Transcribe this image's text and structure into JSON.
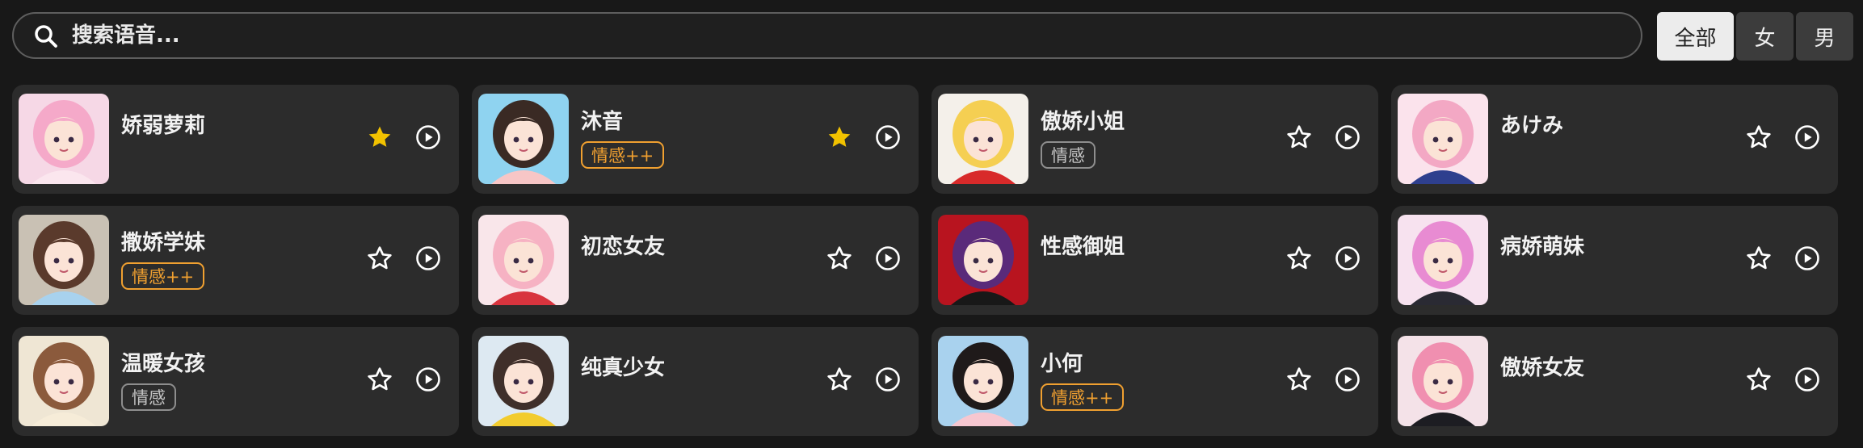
{
  "search": {
    "placeholder": "搜索语音..."
  },
  "filters": [
    {
      "label": "全部",
      "active": true
    },
    {
      "label": "女",
      "active": false
    },
    {
      "label": "男",
      "active": false
    }
  ],
  "colors": {
    "favorite": "#f2c200",
    "tag_plus": "#f0a030",
    "tag_plain": "#8e8e8e",
    "card_bg": "#2c2c2c"
  },
  "voices": [
    {
      "name": "娇弱萝莉",
      "tag": "",
      "favorite": true,
      "palette": [
        "#f6d8e6",
        "#f5a9c9",
        "#fbe6ee"
      ]
    },
    {
      "name": "沐音",
      "tag": "情感++",
      "favorite": true,
      "palette": [
        "#8fd3f0",
        "#3a2a24",
        "#f7c6c6"
      ]
    },
    {
      "name": "傲娇小姐",
      "tag": "情感",
      "favorite": false,
      "palette": [
        "#f4f0ea",
        "#f5cf52",
        "#d82a2a"
      ]
    },
    {
      "name": "あけみ",
      "tag": "",
      "favorite": false,
      "palette": [
        "#fbe3ec",
        "#f3a8c4",
        "#2e3f8e"
      ]
    },
    {
      "name": "撒娇学妹",
      "tag": "情感++",
      "favorite": false,
      "palette": [
        "#c9c1b4",
        "#5a3a2c",
        "#a8d2ee"
      ]
    },
    {
      "name": "初恋女友",
      "tag": "",
      "favorite": false,
      "palette": [
        "#f9e6ea",
        "#f6b2c3",
        "#d8343e"
      ]
    },
    {
      "name": "性感御姐",
      "tag": "",
      "favorite": false,
      "palette": [
        "#b8141f",
        "#5a2a7a",
        "#181818"
      ]
    },
    {
      "name": "病娇萌妹",
      "tag": "",
      "favorite": false,
      "palette": [
        "#f7e2ef",
        "#e88bd2",
        "#2a2a33"
      ]
    },
    {
      "name": "温暖女孩",
      "tag": "情感",
      "favorite": false,
      "palette": [
        "#efe6d4",
        "#8b5a3c",
        "#f6ecd8"
      ]
    },
    {
      "name": "纯真少女",
      "tag": "",
      "favorite": false,
      "palette": [
        "#dde9f2",
        "#3f2f2a",
        "#f2cc2e"
      ]
    },
    {
      "name": "小何",
      "tag": "情感++",
      "favorite": false,
      "palette": [
        "#a9d2ee",
        "#1f1a1a",
        "#f6c7d0"
      ]
    },
    {
      "name": "傲娇女友",
      "tag": "",
      "favorite": false,
      "palette": [
        "#f4e2e8",
        "#f08fb0",
        "#1d1d22"
      ]
    }
  ]
}
